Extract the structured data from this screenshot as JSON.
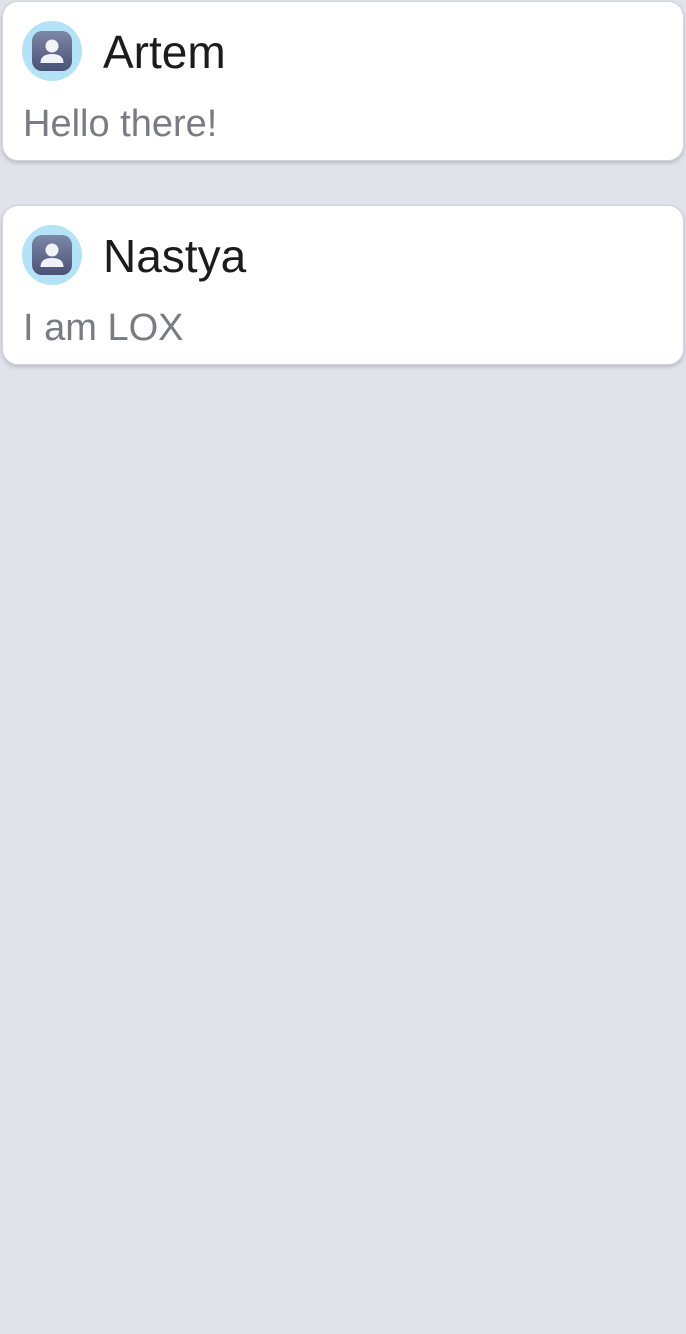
{
  "posts": [
    {
      "author": "Artem",
      "message": "Hello there!",
      "avatar_icon": "user-avatar-icon"
    },
    {
      "author": "Nastya",
      "message": "I am LOX",
      "avatar_icon": "user-avatar-icon"
    }
  ],
  "colors": {
    "background": "#e0e3ea",
    "card": "#ffffff",
    "author_text": "#1c1c1c",
    "message_text": "#7b7b84",
    "avatar_ring": "#b4e2f7",
    "avatar_tile": "#5d678a"
  }
}
